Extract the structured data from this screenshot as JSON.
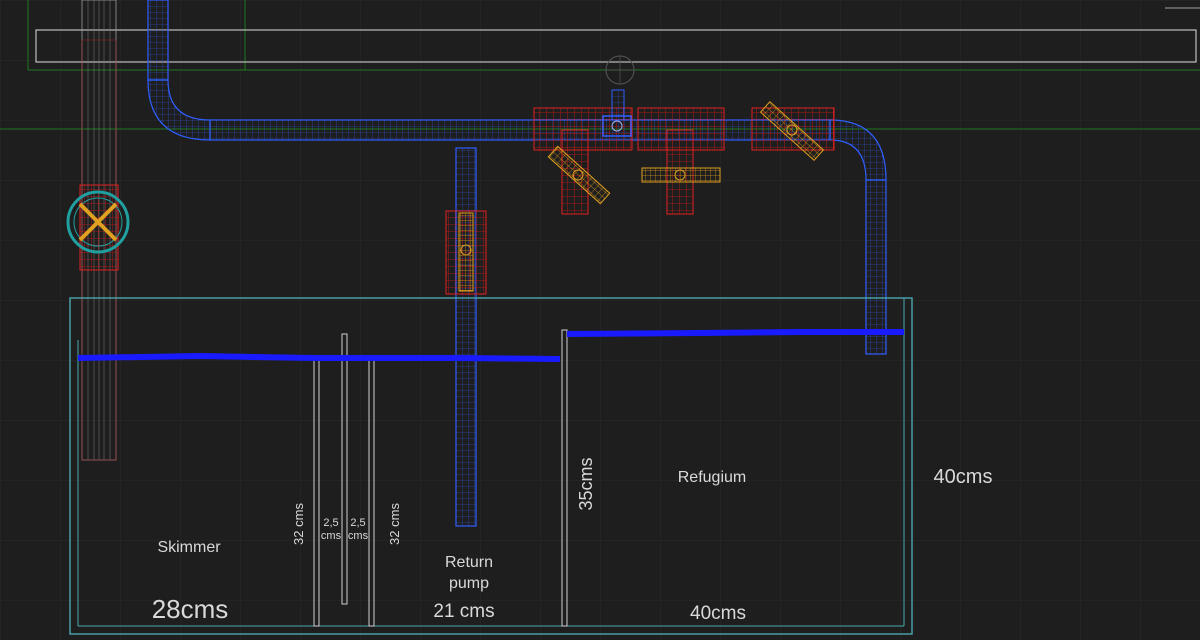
{
  "labels": {
    "skimmer": "Skimmer",
    "return_pump_line1": "Return",
    "return_pump_line2": "pump",
    "refugium": "Refugium",
    "baffle_height_left": "32 cms",
    "baffle_height_right": "32 cms",
    "gap_left_line1": "2,5",
    "gap_left_line2": "cms",
    "gap_right_line1": "2,5",
    "gap_right_line2": "cms",
    "refugium_divider_height": "35cms",
    "tank_height": "40cms",
    "skimmer_width": "28cms",
    "return_width": "21 cms",
    "refugium_width": "40cms"
  },
  "colors": {
    "background": "#1e1e1e",
    "grid": "#2b2b2b",
    "pipe": "#2f5fff",
    "water": "#1a1aff",
    "valve_frame": "#e02020",
    "valve_handle": "#e0a020",
    "tank_outline": "#4aa8b0",
    "baffle": "#d0d0d0",
    "ball_valve_ring": "#20a0a0",
    "guide_line": "#1f7a1f",
    "label_text": "#d9d9d9"
  },
  "icons": {
    "ball_valve": "ball-valve-icon",
    "union_valve": "union-valve-icon",
    "pump": "pump-icon"
  }
}
